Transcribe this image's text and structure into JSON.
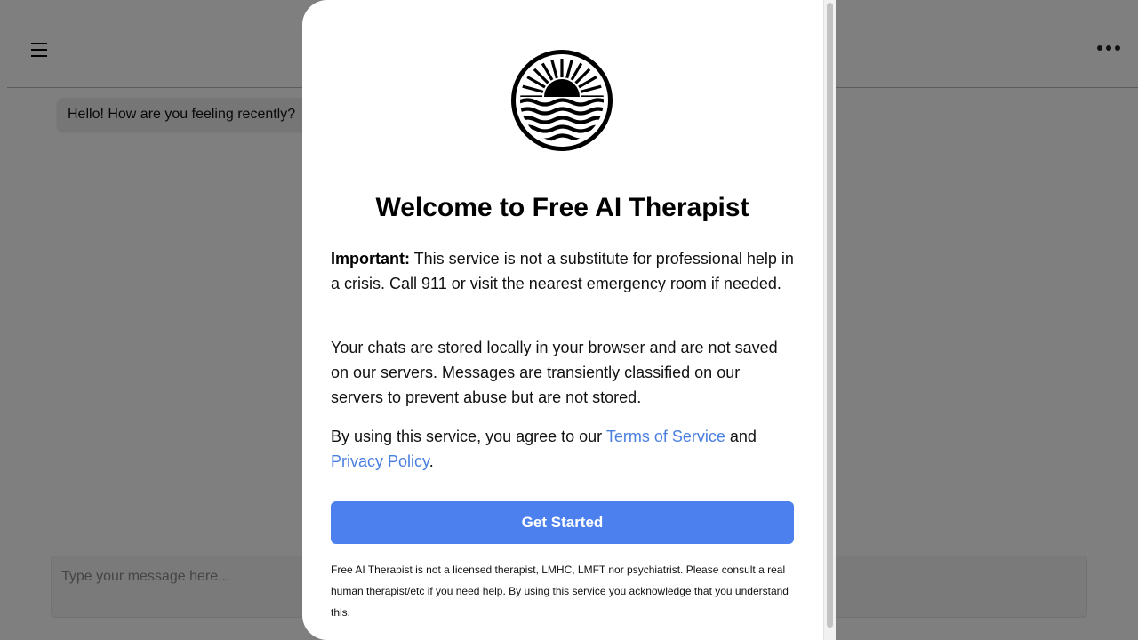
{
  "app": {
    "greeting": "Hello! How are you feeling recently?",
    "composer_placeholder": "Type your message here..."
  },
  "icons": {
    "menu": "hamburger-menu-icon",
    "more": "more-horizontal-icon",
    "logo": "sunrise-over-waves-logo"
  },
  "modal": {
    "title": "Welcome to Free AI Therapist",
    "important_label": "Important:",
    "important_text": " This service is not a substitute for professional help in a crisis. Call 911 or visit the nearest emergency room if needed.",
    "privacy_text": "Your chats are stored locally in your browser and are not saved on our servers. Messages are transiently classified on our servers to prevent abuse but are not stored.",
    "agree_prefix": "By using this service, you agree to our ",
    "terms_link": "Terms of Service",
    "agree_and": " and ",
    "privacy_link": "Privacy Policy",
    "agree_suffix": ".",
    "cta_label": "Get Started",
    "footnote": "Free AI Therapist is not a licensed therapist, LMHC, LMFT nor psychiatrist. Please consult a real human therapist/etc if you need help. By using this service you acknowledge that you understand this."
  },
  "colors": {
    "accent": "#4b80ee",
    "link": "#4a7fe0",
    "overlay": "rgba(0,0,0,0.5)"
  }
}
